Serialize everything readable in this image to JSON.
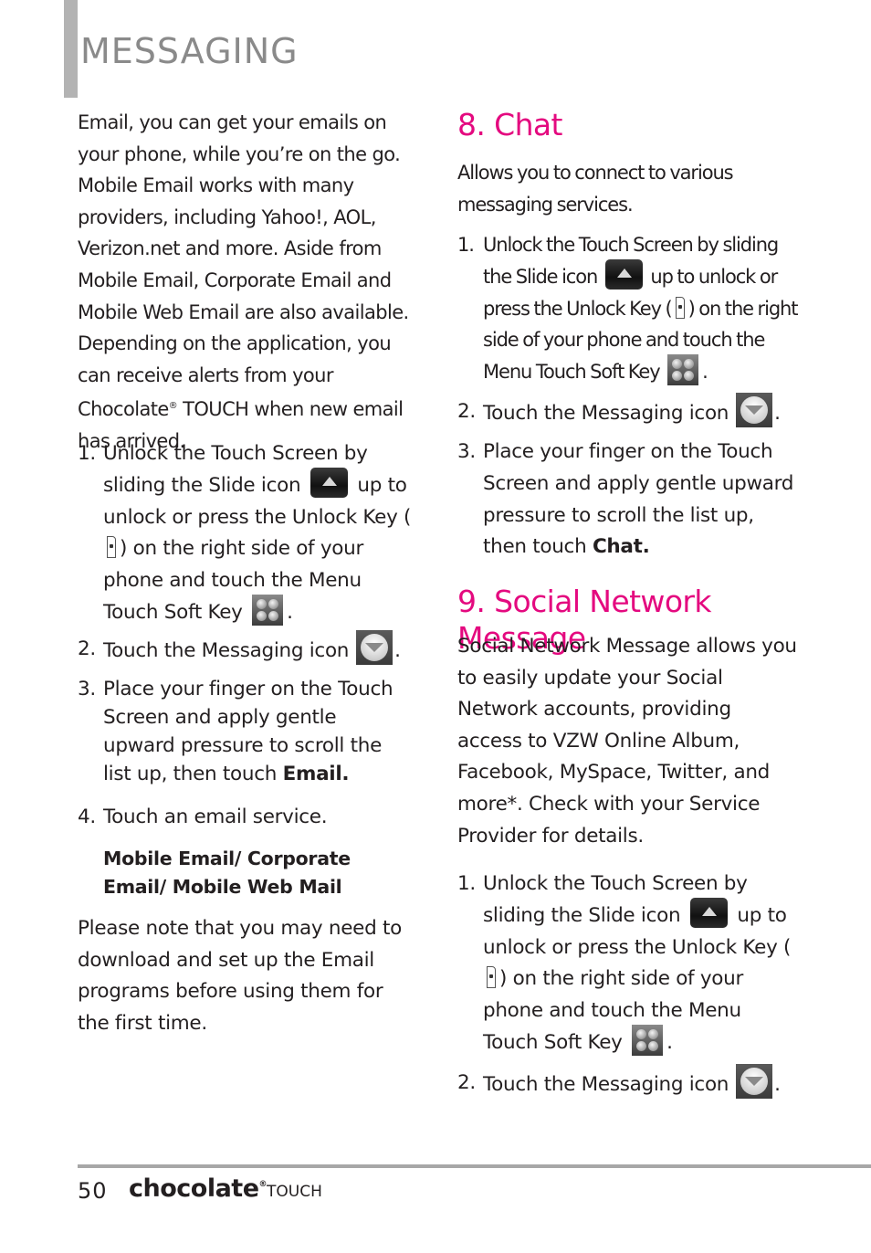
{
  "header": {
    "section_title": "MESSAGING"
  },
  "left": {
    "intro": "Email, you can get your emails on your phone, while you’re on the go. Mobile Email works with many providers, including Yahoo!, AOL, Verizon.net and more. Aside from Mobile Email, Corporate Email and Mobile Web Email are also available. Depending on the application, you can receive alerts from your Chocolate",
    "intro_reg": "®",
    "intro_tail": " TOUCH when new email has arrived.",
    "steps": [
      {
        "num": "1.",
        "a": "Unlock the Touch Screen by sliding the Slide icon",
        "b": "up to unlock or press the Unlock Key (",
        "c": ") on the right side of your phone and touch the Menu Touch Soft Key",
        "d": "."
      },
      {
        "num": "2.",
        "a": "Touch the Messaging icon",
        "b": "."
      },
      {
        "num": "3.",
        "a": "Place your finger on the Touch Screen and apply gentle upward pressure to scroll the list up, then touch ",
        "bold": "Email."
      },
      {
        "num": "4.",
        "a": "Touch an email service."
      }
    ],
    "options": "Mobile Email/ Corporate Email/ Mobile Web Mail",
    "note": "Please note that you may need to download and set up the Email programs before using them for the first time."
  },
  "chat": {
    "heading": "8. Chat",
    "intro": "Allows you to connect to various messaging services.",
    "steps": [
      {
        "num": "1.",
        "a": "Unlock the Touch Screen by sliding the Slide icon",
        "b": "up to unlock or press the Unlock Key (",
        "c": ") on the right side of your phone and touch the Menu Touch Soft Key",
        "d": "."
      },
      {
        "num": "2.",
        "a": "Touch the Messaging icon",
        "b": "."
      },
      {
        "num": "3.",
        "a": "Place your finger on the Touch Screen and apply gentle upward pressure to scroll the list up, then touch ",
        "bold": "Chat."
      }
    ]
  },
  "social": {
    "heading": "9. Social Network Message",
    "intro": "Social Network Message allows you to easily update your Social Network accounts, providing access to VZW Online Album, Facebook, MySpace, Twitter, and more*. Check with your Service Provider for details.",
    "steps": [
      {
        "num": "1.",
        "a": "Unlock the Touch Screen by sliding the Slide icon",
        "b": "up to unlock or press the Unlock Key (",
        "c": ") on the right side of your phone and touch the Menu Touch Soft Key",
        "d": "."
      },
      {
        "num": "2.",
        "a": "Touch the Messaging icon",
        "b": "."
      }
    ]
  },
  "footer": {
    "page_number": "50",
    "brand": "chocolate",
    "brand_reg": "®",
    "brand_suffix": "TOUCH"
  },
  "colors": {
    "heading_accent": "#e4097f",
    "title_gray": "#8a8a8a",
    "rule_gray": "#a7a7a7"
  }
}
